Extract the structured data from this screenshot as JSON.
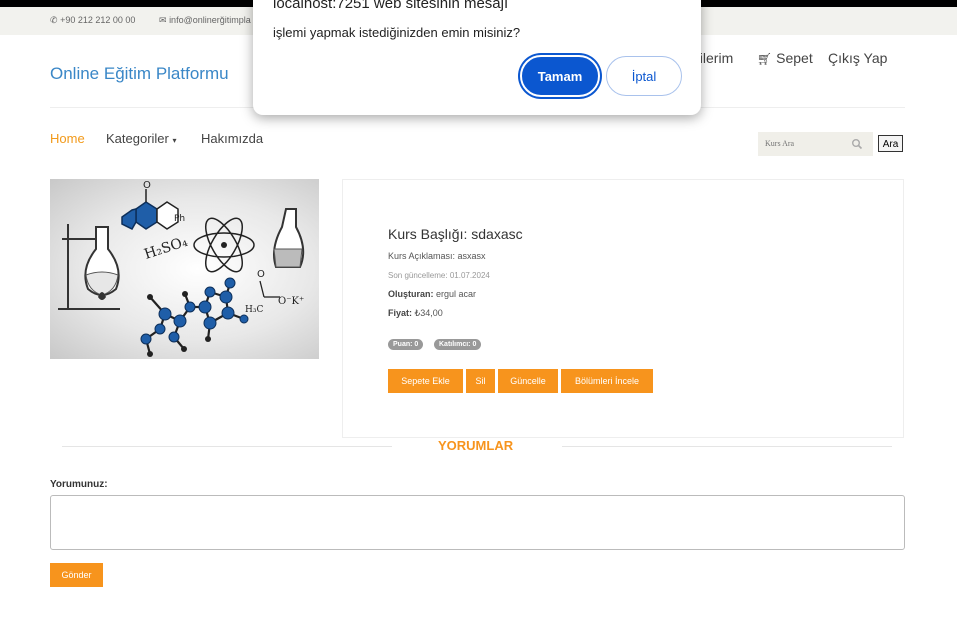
{
  "topbar": {
    "phone": "+90 212 212 00 00",
    "email": "info@onlinerğitimpla",
    "phone_icon": "phone-icon",
    "email_icon": "envelope-icon"
  },
  "header": {
    "brand": "Online Eğitim Platformu",
    "user_nav": [
      "ğilerim",
      "Sepet",
      "Çıkış Yap"
    ],
    "cart_icon": "cart-icon"
  },
  "nav": {
    "home": "Home",
    "categories": "Kategoriler",
    "about": "Hakımızda",
    "search_placeholder": "Kurs Ara",
    "search_button": "Ara"
  },
  "course": {
    "title": "Kurs Başlığı: sdaxasc",
    "desc_label": "Kurs Açıklaması:",
    "desc_value": "asxasx",
    "updated": "Son güncelleme: 01.07.2024",
    "creator_label": "Oluşturan:",
    "creator_value": "ergul acar",
    "price_label": "Fiyat:",
    "price_value": "₺34,00",
    "badge_score": "Puan: 0",
    "badge_participants": "Katılımcı: 0",
    "buttons": [
      "Sepete Ekle",
      "Sil",
      "Güncelle",
      "Bölümleri İncele"
    ],
    "image_formula": "H₂SO₄",
    "image_labels": [
      "O",
      "Ph",
      "H₃C",
      "O⁻K⁺",
      "O"
    ]
  },
  "comments": {
    "heading": "YORUMLAR",
    "label": "Yorumunuz:",
    "submit": "Gönder"
  },
  "dialog": {
    "title": "localhost:7251 web sitesinin mesajı",
    "message": "işlemi yapmak istediğinizden emin misiniz?",
    "ok": "Tamam",
    "cancel": "İptal"
  },
  "colors": {
    "accent": "#f7941d",
    "brand": "#3a87c7",
    "dialog_primary": "#0b57d0",
    "molecule": "#1f5ea8"
  }
}
